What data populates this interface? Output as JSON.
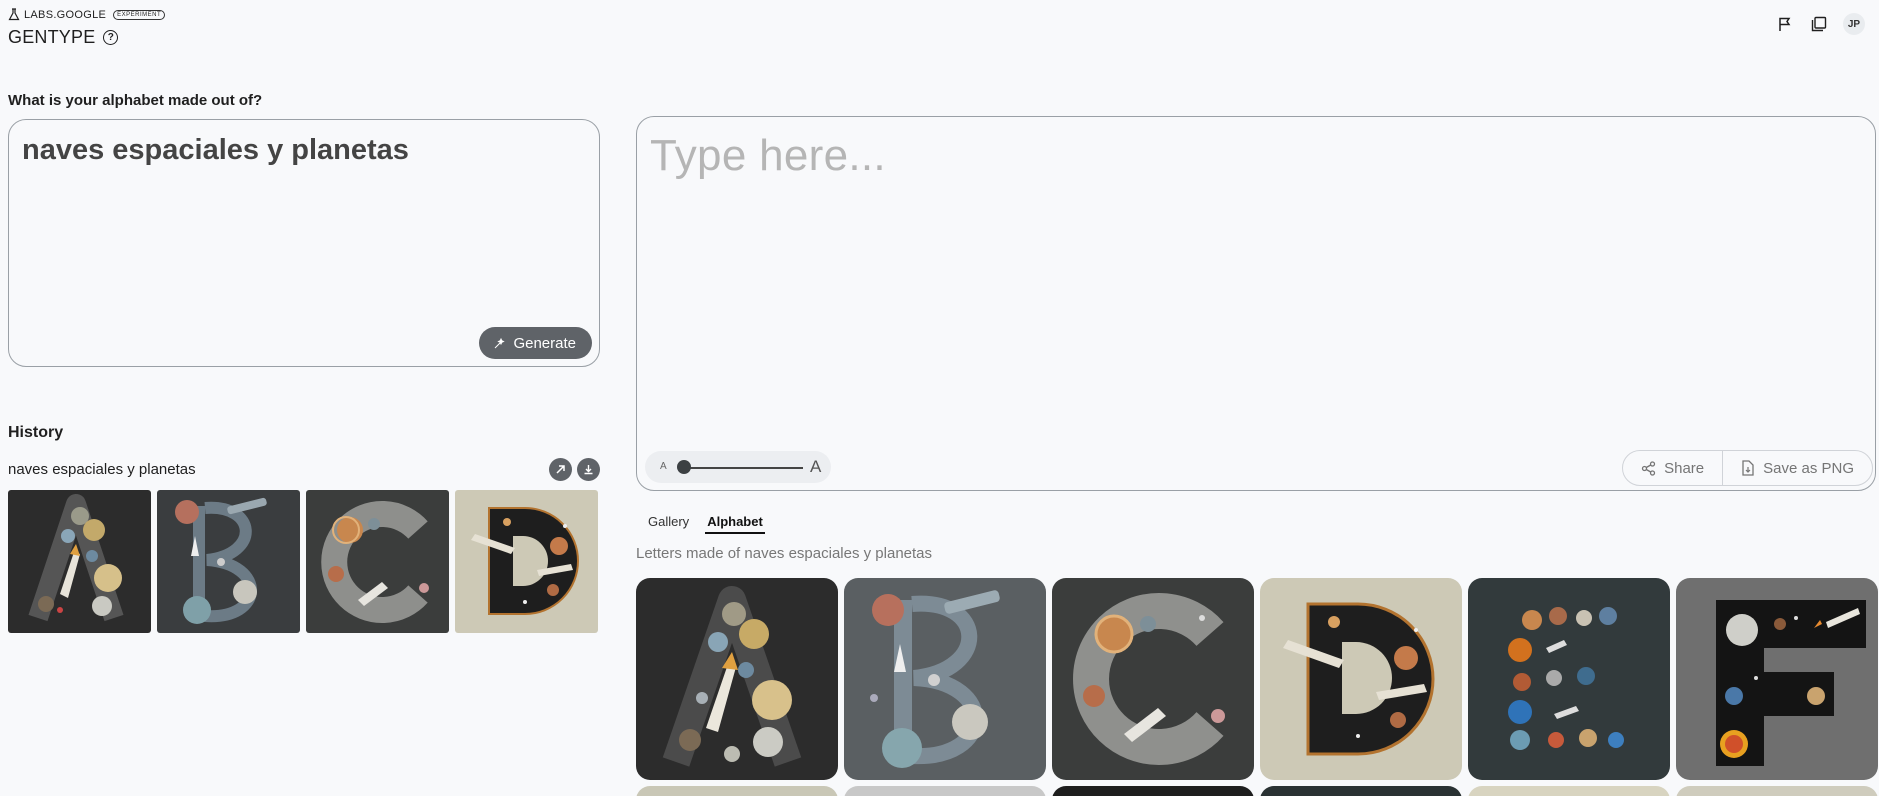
{
  "header": {
    "brand": "LABS.GOOGLE",
    "badge": "EXPERIMENT",
    "title": "GENTYPE",
    "help_icon": "help-circle-icon",
    "actions": [
      {
        "name": "report-flag-icon"
      },
      {
        "name": "copy-gallery-icon"
      }
    ],
    "avatar_initials": "JP"
  },
  "prompt": {
    "label": "What is your alphabet made out of?",
    "value": "naves espaciales y planetas",
    "generate_label": "Generate"
  },
  "history": {
    "title": "History",
    "items": [
      {
        "name": "naves espaciales y planetas",
        "letters": [
          "A",
          "B",
          "C",
          "D"
        ]
      }
    ]
  },
  "canvas": {
    "placeholder": "Type here...",
    "size_small": "A",
    "size_large": "A",
    "share_label": "Share",
    "save_label": "Save as PNG"
  },
  "tabs": [
    {
      "label": "Gallery",
      "active": false
    },
    {
      "label": "Alphabet",
      "active": true
    }
  ],
  "alphabet": {
    "subtitle": "Letters made of naves espaciales y planetas",
    "letters": [
      {
        "letter": "A",
        "bg": "#2c2c2c"
      },
      {
        "letter": "B",
        "bg": "#5a5f62"
      },
      {
        "letter": "C",
        "bg": "#3b3d3c"
      },
      {
        "letter": "D",
        "bg": "#cdc9b6"
      },
      {
        "letter": "E",
        "bg": "#323a3c"
      },
      {
        "letter": "F",
        "bg": "#6f6f6f"
      }
    ],
    "next_row_bgs": [
      "#c9c7b6",
      "#c8c8c8",
      "#1e1e1e",
      "#2a3233",
      "#d8d4c0",
      "#cfccbd"
    ]
  },
  "colors": {
    "accent": "#5f6368",
    "background": "#f8f9fb",
    "border": "#9aa0a6"
  }
}
